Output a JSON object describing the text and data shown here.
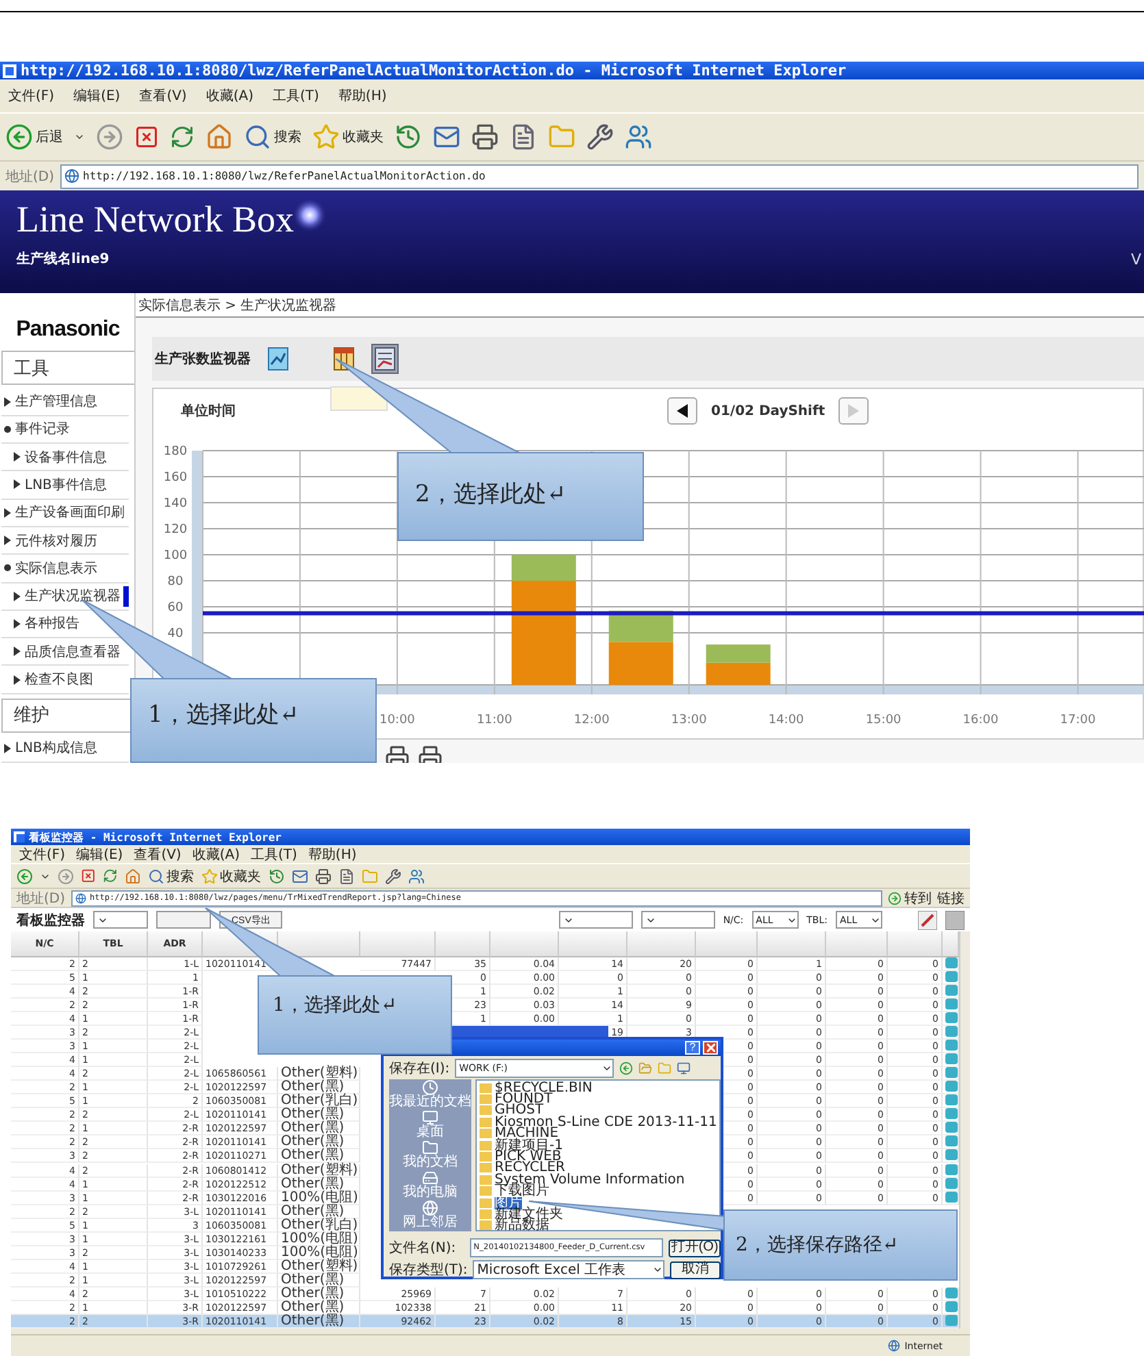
{
  "screenshot_1": {
    "window": {
      "title": "http://192.168.10.1:8080/lwz/ReferPanelActualMonitorAction.do - Microsoft Internet Explorer"
    },
    "menu": [
      "文件(F)",
      "编辑(E)",
      "查看(V)",
      "收藏(A)",
      "工具(T)",
      "帮助(H)"
    ],
    "toolbar": {
      "back_label": "后退",
      "search_label": "搜索",
      "favorites_label": "收藏夹"
    },
    "address": {
      "label": "地址(D)",
      "url": "http://192.168.10.1:8080/lwz/ReferPanelActualMonitorAction.do"
    },
    "header": {
      "title": "Line Network Box",
      "line_name": "生产线名line9",
      "right_text": "V"
    },
    "breadcrumb": "实际信息表示 > 生产状况监视器",
    "sidebar": {
      "logo": "Panasonic",
      "sections": [
        {
          "title": "工具",
          "items": [
            {
              "label": "生产管理信息",
              "selected": false
            },
            {
              "label": "事件记录",
              "selected": false,
              "children": [
                {
                  "label": "设备事件信息",
                  "selected": false
                },
                {
                  "label": "LNB事件信息",
                  "selected": false
                }
              ]
            },
            {
              "label": "生产设备画面印刷",
              "selected": false
            },
            {
              "label": "元件核对履历",
              "selected": false
            },
            {
              "label": "实际信息表示",
              "selected": false,
              "children": [
                {
                  "label": "生产状况监视器",
                  "selected": true
                },
                {
                  "label": "各种报告",
                  "selected": false
                },
                {
                  "label": "品质信息查看器",
                  "selected": false
                },
                {
                  "label": "检查不良图",
                  "selected": false
                }
              ]
            }
          ]
        },
        {
          "title": "维护",
          "items": [
            {
              "label": "LNB构成信息",
              "selected": false
            }
          ]
        }
      ]
    },
    "panel": {
      "title": "生产张数监视器",
      "views": [
        {
          "kind": "chart",
          "selected": false
        },
        {
          "kind": "table",
          "selected": false
        },
        {
          "kind": "report",
          "selected": true
        }
      ],
      "nav": {
        "period": "01/02 DayShift",
        "prev_enabled": true,
        "next_enabled": false
      },
      "chart_data": {
        "type": "bar",
        "stacked": true,
        "ylabel": "单位时间",
        "x": [
          10.5,
          11.5,
          12.5,
          13.5,
          14.5,
          15.5,
          16.5
        ],
        "series": [
          {
            "color": "#e8890c",
            "values": [
              0,
              80,
              33,
              17,
              0,
              0,
              0
            ]
          },
          {
            "color": "#9bbb59",
            "values": [
              0,
              20,
              24,
              14,
              0,
              0,
              0
            ]
          }
        ],
        "xlim": [
          8,
          17.68
        ],
        "xticks": [
          {
            "value": 10,
            "label": "10:00"
          },
          {
            "value": 11,
            "label": "11:00"
          },
          {
            "value": 12,
            "label": "12:00"
          },
          {
            "value": 13,
            "label": "13:00"
          },
          {
            "value": 14,
            "label": "14:00"
          },
          {
            "value": 15,
            "label": "15:00"
          },
          {
            "value": 16,
            "label": "16:00"
          },
          {
            "value": 17,
            "label": "17:00"
          }
        ],
        "ylim": [
          0,
          180
        ],
        "yticks": [
          40,
          60,
          80,
          100,
          120,
          140,
          160,
          180
        ],
        "grid": true,
        "ref_lines": [
          {
            "axis": "y",
            "value": 55,
            "color": "#1c1cc0"
          }
        ]
      }
    },
    "callouts": [
      {
        "text": "2，选择此处↵"
      },
      {
        "text": "1，选择此处↵"
      }
    ]
  },
  "screenshot_2": {
    "window": {
      "title": "看板监控器 - Microsoft Internet Explorer"
    },
    "menu": [
      "文件(F)",
      "编辑(E)",
      "查看(V)",
      "收藏(A)",
      "工具(T)",
      "帮助(H)"
    ],
    "toolbar": {
      "search_label": "搜索",
      "favorites_label": "收藏夹"
    },
    "address": {
      "label": "地址(D)",
      "url": "http://192.168.10.1:8080/lwz/pages/menu/TrMixedTrendReport.jsp?lang=Chinese",
      "go_label": "转到",
      "links_label": "链接"
    },
    "controls": {
      "title": "看板监控器",
      "export_button": "CSV导出",
      "nc_label": "N/C:",
      "nc_value": "ALL",
      "tbl_label": "TBL:",
      "tbl_value": "ALL"
    },
    "table": {
      "columns": [
        "N/C",
        "TBL",
        "ADR"
      ],
      "rows": [
        {
          "selected": false,
          "cells": [
            "2",
            "2",
            "1-L",
            "1020110141",
            null,
            "77447",
            "35",
            "0.04",
            "14",
            "20",
            "0",
            "1",
            "0",
            "0"
          ]
        },
        {
          "selected": false,
          "cells": [
            "5",
            "1",
            "1",
            null,
            null,
            null,
            "0",
            "0.00",
            "0",
            "0",
            "0",
            "0",
            "0",
            "0"
          ]
        },
        {
          "selected": false,
          "cells": [
            "4",
            "2",
            "1-R",
            null,
            null,
            null,
            "1",
            "0.02",
            "1",
            "0",
            "0",
            "0",
            "0",
            "0"
          ]
        },
        {
          "selected": false,
          "cells": [
            "2",
            "2",
            "1-R",
            null,
            null,
            null,
            "23",
            "0.03",
            "14",
            "9",
            "0",
            "0",
            "0",
            "0"
          ]
        },
        {
          "selected": false,
          "cells": [
            "4",
            "1",
            "1-R",
            null,
            null,
            null,
            "1",
            "0.00",
            "1",
            "0",
            "0",
            "0",
            "0",
            "0"
          ]
        },
        {
          "selected": false,
          "cells": [
            "3",
            "2",
            "2-L",
            null,
            null,
            null,
            null,
            null,
            "19",
            "3",
            "0",
            "0",
            "0",
            "0"
          ]
        },
        {
          "selected": false,
          "cells": [
            "3",
            "1",
            "2-L",
            null,
            null,
            null,
            null,
            null,
            null,
            null,
            "0",
            "0",
            "0",
            "0"
          ]
        },
        {
          "selected": false,
          "cells": [
            "4",
            "1",
            "2-L",
            null,
            null,
            null,
            null,
            null,
            null,
            null,
            "0",
            "0",
            "0",
            "0"
          ]
        },
        {
          "selected": false,
          "cells": [
            "4",
            "2",
            "2-L",
            "1065860561",
            "Other(塑料)",
            null,
            null,
            null,
            null,
            null,
            "0",
            "0",
            "0",
            "0"
          ]
        },
        {
          "selected": false,
          "cells": [
            "2",
            "1",
            "2-L",
            "1020122597",
            "Other(黑)",
            null,
            null,
            null,
            null,
            null,
            "0",
            "0",
            "0",
            "0"
          ]
        },
        {
          "selected": false,
          "cells": [
            "5",
            "1",
            "2",
            "1060350081",
            "Other(乳白)",
            null,
            null,
            null,
            null,
            null,
            "0",
            "0",
            "0",
            "0"
          ]
        },
        {
          "selected": false,
          "cells": [
            "2",
            "2",
            "2-L",
            "1020110141",
            "Other(黑)",
            null,
            null,
            null,
            null,
            null,
            "0",
            "0",
            "0",
            "0"
          ]
        },
        {
          "selected": false,
          "cells": [
            "2",
            "1",
            "2-R",
            "1020122597",
            "Other(黑)",
            null,
            null,
            null,
            null,
            null,
            "0",
            "0",
            "0",
            "0"
          ]
        },
        {
          "selected": false,
          "cells": [
            "2",
            "2",
            "2-R",
            "1020110141",
            "Other(黑)",
            null,
            null,
            null,
            null,
            null,
            "0",
            "0",
            "0",
            "0"
          ]
        },
        {
          "selected": false,
          "cells": [
            "3",
            "2",
            "2-R",
            "1020110271",
            "Other(黑)",
            null,
            null,
            null,
            null,
            null,
            "0",
            "0",
            "0",
            "0"
          ]
        },
        {
          "selected": false,
          "cells": [
            "4",
            "2",
            "2-R",
            "1060801412",
            "Other(塑料)",
            null,
            null,
            null,
            null,
            null,
            "0",
            "0",
            "0",
            "0"
          ]
        },
        {
          "selected": false,
          "cells": [
            "4",
            "1",
            "2-R",
            "1020122512",
            "Other(黑)",
            null,
            null,
            null,
            null,
            null,
            "0",
            "0",
            "0",
            "0"
          ]
        },
        {
          "selected": false,
          "cells": [
            "3",
            "1",
            "2-R",
            "1030122016",
            "100%(电阻)",
            null,
            null,
            null,
            null,
            null,
            "0",
            "0",
            "0",
            "0"
          ]
        },
        {
          "selected": false,
          "cells": [
            "2",
            "2",
            "3-L",
            "1020110141",
            "Other(黑)",
            null,
            null,
            null,
            null,
            null,
            null,
            null,
            null,
            null
          ]
        },
        {
          "selected": false,
          "cells": [
            "5",
            "1",
            "3",
            "1060350081",
            "Other(乳白)",
            null,
            null,
            null,
            null,
            null,
            null,
            null,
            null,
            null
          ]
        },
        {
          "selected": false,
          "cells": [
            "3",
            "1",
            "3-L",
            "1030122161",
            "100%(电阻)",
            null,
            null,
            null,
            null,
            null,
            null,
            null,
            null,
            null
          ]
        },
        {
          "selected": false,
          "cells": [
            "3",
            "2",
            "3-L",
            "1030140233",
            "100%(电阻)",
            null,
            null,
            null,
            null,
            null,
            null,
            null,
            null,
            null
          ]
        },
        {
          "selected": false,
          "cells": [
            "4",
            "1",
            "3-L",
            "1010729261",
            "Other(塑料)",
            null,
            null,
            null,
            null,
            null,
            null,
            null,
            null,
            null
          ]
        },
        {
          "selected": false,
          "cells": [
            "2",
            "1",
            "3-L",
            "1020122597",
            "Other(黑)",
            null,
            null,
            null,
            null,
            null,
            null,
            null,
            null,
            null
          ]
        },
        {
          "selected": false,
          "cells": [
            "4",
            "2",
            "3-L",
            "1010510222",
            "Other(黑)",
            "25969",
            "7",
            "0.02",
            "7",
            "0",
            "0",
            "0",
            "0",
            "0"
          ]
        },
        {
          "selected": false,
          "cells": [
            "2",
            "1",
            "3-R",
            "1020122597",
            "Other(黑)",
            "102338",
            "21",
            "0.00",
            "11",
            "20",
            "0",
            "0",
            "0",
            "0"
          ]
        },
        {
          "selected": true,
          "cells": [
            "2",
            "2",
            "3-R",
            "1020110141",
            "Other(黑)",
            "92462",
            "23",
            "0.02",
            "8",
            "15",
            "0",
            "0",
            "0",
            "0"
          ]
        }
      ]
    },
    "dialog": {
      "help": "?",
      "save_in_label": "保存在(I):",
      "location": "WORK (F:)",
      "places": [
        "我最近的文档",
        "桌面",
        "我的文档",
        "我的电脑",
        "网上邻居"
      ],
      "folders": [
        {
          "name": "$RECYCLE.BIN",
          "selected": false
        },
        {
          "name": "FOUNDT",
          "selected": false
        },
        {
          "name": "GHOST",
          "selected": false
        },
        {
          "name": "Kiosmon S-Line CDE 2013-11-11",
          "selected": false
        },
        {
          "name": "MACHINE",
          "selected": false
        },
        {
          "name": "新建项目-1",
          "selected": false
        },
        {
          "name": "PICK WEB",
          "selected": false
        },
        {
          "name": "RECYCLER",
          "selected": false
        },
        {
          "name": "System Volume Information",
          "selected": false
        },
        {
          "name": "下载图片",
          "selected": false
        },
        {
          "name": "图片",
          "selected": true
        },
        {
          "name": "新建文件夹",
          "selected": false
        },
        {
          "name": "新品数据",
          "selected": false
        }
      ],
      "file_name_label": "文件名(N):",
      "file_name": "N_20140102134800_Feeder_D_Current.csv",
      "type_label": "保存类型(T):",
      "type": "Microsoft Excel 工作表",
      "buttons": [
        "打开(O)",
        "取消"
      ]
    },
    "status": {
      "zone": "Internet"
    },
    "callouts": [
      {
        "text": "1，选择此处↵"
      },
      {
        "text": "2，选择保存路径↵"
      }
    ]
  }
}
